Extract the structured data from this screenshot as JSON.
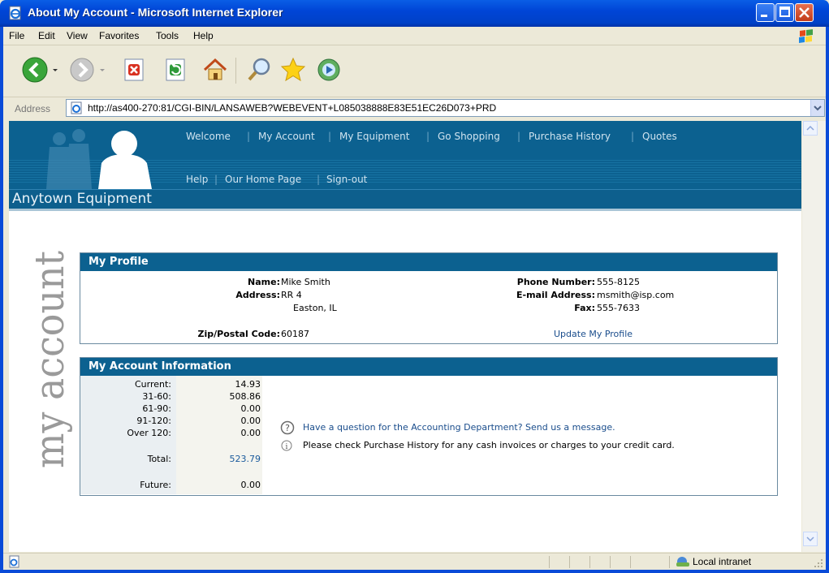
{
  "window": {
    "title": "About My Account - Microsoft Internet Explorer"
  },
  "menu": {
    "items": [
      "File",
      "Edit",
      "View",
      "Favorites",
      "Tools",
      "Help"
    ]
  },
  "address": {
    "label": "Address",
    "url": "http://as400-270:81/CGI-BIN/LANSAWEB?WEBEVENT+L085038888E83E51EC26D073+PRD"
  },
  "toolbar": {
    "buttons": [
      "back-icon",
      "forward-icon",
      "stop-icon",
      "refresh-icon",
      "home-icon",
      "search-icon",
      "favorites-icon",
      "media-icon"
    ]
  },
  "site": {
    "company": "Anytown Equipment",
    "nav_top": [
      "Welcome",
      "My Account",
      "My Equipment",
      "Go Shopping",
      "Purchase History",
      "Quotes"
    ],
    "nav_bottom": [
      "Help",
      "Our Home Page",
      "Sign-out"
    ],
    "side_text": "my account"
  },
  "profile": {
    "heading": "My Profile",
    "name_label": "Name:",
    "name": "Mike Smith",
    "address_label": "Address:",
    "address1": "RR 4",
    "address2": "Easton, IL",
    "zip_label": "Zip/Postal Code:",
    "zip": "60187",
    "phone_label": "Phone Number:",
    "phone": "555-8125",
    "email_label": "E-mail Address:",
    "email": "msmith@isp.com",
    "fax_label": "Fax:",
    "fax": "555-7633",
    "update_link": "Update My Profile"
  },
  "account": {
    "heading": "My Account Information",
    "aging": [
      {
        "label": "Current:",
        "value": "14.93"
      },
      {
        "label": "31-60:",
        "value": "508.86"
      },
      {
        "label": "61-90:",
        "value": "0.00"
      },
      {
        "label": "91-120:",
        "value": "0.00"
      },
      {
        "label": "Over 120:",
        "value": "0.00"
      }
    ],
    "total_label": "Total:",
    "total": "523.79",
    "future_label": "Future:",
    "future": "0.00",
    "question_link": "Have a question for the Accounting Department? Send us a message.",
    "info_text": "Please check Purchase History for any cash invoices or charges to your credit card."
  },
  "status": {
    "zone": "Local intranet"
  }
}
